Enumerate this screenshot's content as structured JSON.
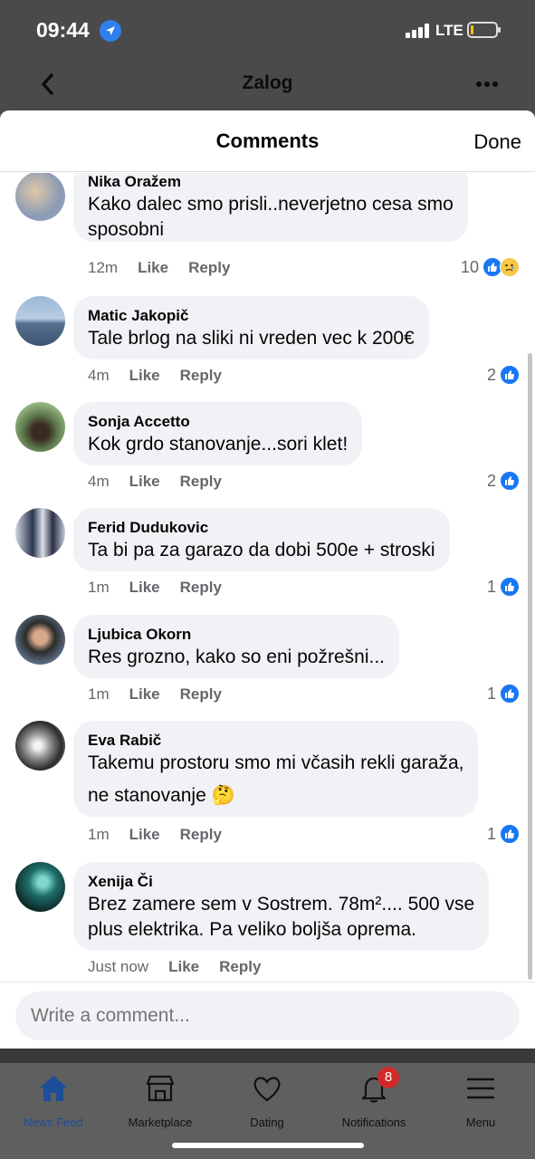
{
  "status_bar": {
    "time": "09:44",
    "network": "LTE"
  },
  "nav": {
    "title": "Zalog"
  },
  "sheet": {
    "title": "Comments",
    "done_label": "Done"
  },
  "comments": [
    {
      "author": "Nika Oražem",
      "lines": [
        "Kako dalec smo prisli..neverjetno cesa smo",
        "sposobni"
      ],
      "time": "12m",
      "like": "Like",
      "reply": "Reply",
      "reactions": "10",
      "reaction_icons": [
        "like-icon",
        "sad-icon"
      ]
    },
    {
      "author": "Matic Jakopič",
      "lines": [
        "Tale brlog na sliki ni vreden vec k 200€"
      ],
      "time": "4m",
      "like": "Like",
      "reply": "Reply",
      "reactions": "2",
      "reaction_icons": [
        "like-icon"
      ]
    },
    {
      "author": "Sonja Accetto",
      "lines": [
        "Kok grdo stanovanje...sori klet!"
      ],
      "time": "4m",
      "like": "Like",
      "reply": "Reply",
      "reactions": "2",
      "reaction_icons": [
        "like-icon"
      ]
    },
    {
      "author": "Ferid Dudukovic",
      "lines": [
        "Ta bi pa za garazo da dobi 500e + stroski"
      ],
      "time": "1m",
      "like": "Like",
      "reply": "Reply",
      "reactions": "1",
      "reaction_icons": [
        "like-icon"
      ]
    },
    {
      "author": "Ljubica Okorn",
      "lines": [
        "Res grozno, kako so eni požrešni..."
      ],
      "time": "1m",
      "like": "Like",
      "reply": "Reply",
      "reactions": "1",
      "reaction_icons": [
        "like-icon"
      ]
    },
    {
      "author": "Eva Rabič",
      "lines": [
        "Takemu prostoru smo mi včasih rekli garaža,",
        "ne stanovanje 🤔"
      ],
      "time": "1m",
      "like": "Like",
      "reply": "Reply",
      "reactions": "1",
      "reaction_icons": [
        "like-icon"
      ]
    },
    {
      "author": "Xenija Či",
      "lines": [
        "Brez zamere sem v Sostrem. 78m².... 500 vse",
        "plus elektrika. Pa veliko boljša oprema."
      ],
      "time": "Just now",
      "like": "Like",
      "reply": "Reply",
      "reactions": "",
      "reaction_icons": []
    }
  ],
  "composer": {
    "placeholder": "Write a comment..."
  },
  "tabbar": {
    "tabs": [
      {
        "label": "News Feed",
        "icon": "home-icon",
        "active": true
      },
      {
        "label": "Marketplace",
        "icon": "marketplace-icon"
      },
      {
        "label": "Dating",
        "icon": "dating-icon"
      },
      {
        "label": "Notifications",
        "icon": "bell-icon",
        "badge": "8"
      },
      {
        "label": "Menu",
        "icon": "menu-icon"
      }
    ]
  },
  "colors": {
    "facebook_blue": "#1877f2",
    "bubble_gray": "#f0f2f5",
    "meta_gray": "#65676b",
    "badge_red": "#d12a2a"
  }
}
